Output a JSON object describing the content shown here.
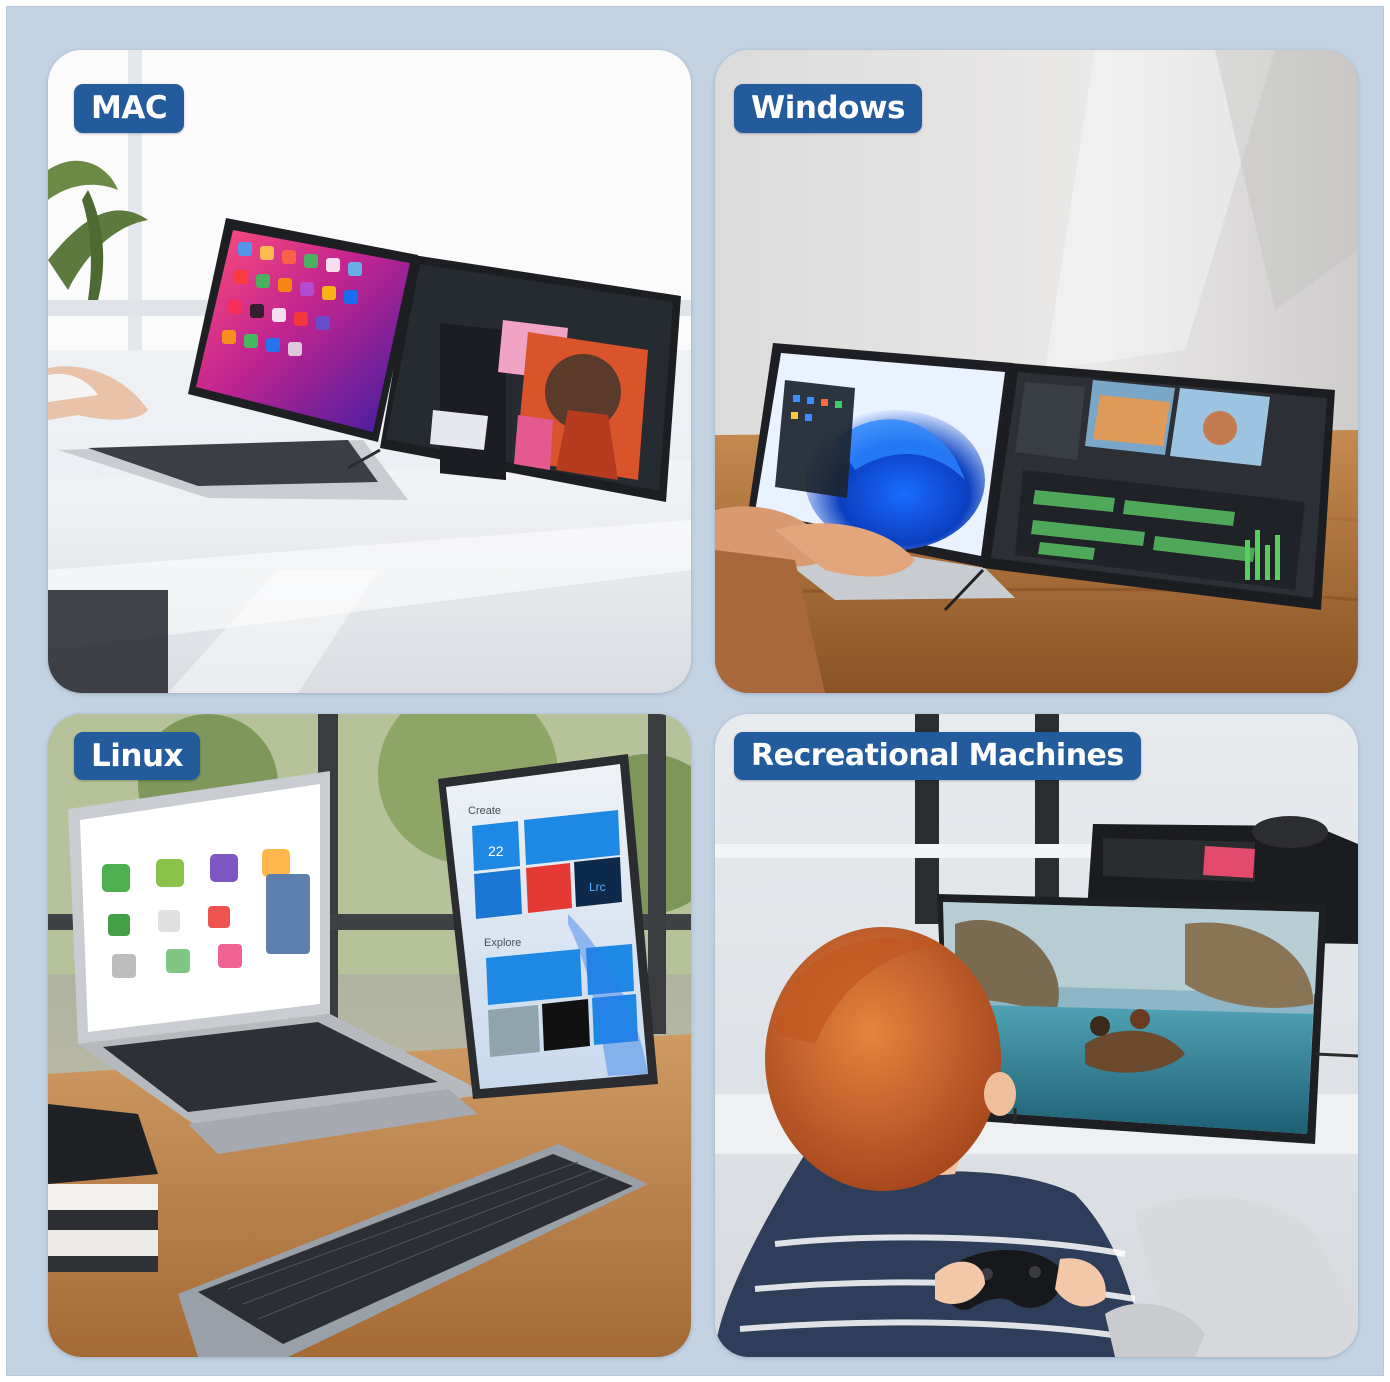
{
  "panels": {
    "mac": {
      "label": "MAC"
    },
    "windows": {
      "label": "Windows"
    },
    "linux": {
      "label": "Linux",
      "tablet": {
        "create": "Create",
        "explore": "Explore",
        "date": "22",
        "lrc": "Lrc"
      }
    },
    "recreational": {
      "label": "Recreational Machines"
    }
  },
  "colors": {
    "frame_background": "#c3d3e3",
    "tag_background": "#245b9c",
    "tag_text": "#ffffff"
  }
}
